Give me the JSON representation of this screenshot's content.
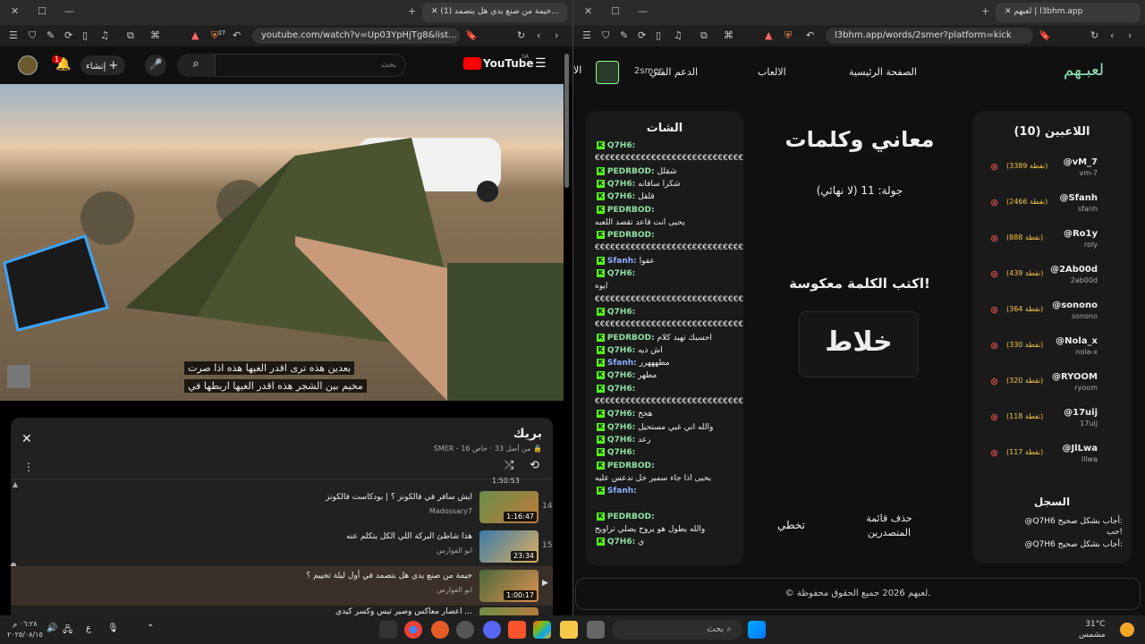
{
  "left_window": {
    "tab_title": "(1) خيمة من صنع يدي هل بتصمد...",
    "url": "youtube.com/watch?v=Up03YpHjTg8&list...",
    "brave_badge": "27"
  },
  "youtube": {
    "logo_text": "YouTube",
    "country": "SA",
    "search_placeholder": "بحث",
    "create_label": "إنشاء",
    "notif_count": "1",
    "subtitle_line1": "بعدين هذه ترى اقدر الغيها هذه اذا صرت",
    "subtitle_line2": "مخيم بين الشجر  هذه اقدر الغيها اربطها في",
    "playlist_title": "بريك",
    "playlist_meta": "SMER - 16 من أصل 33",
    "playlist_owner_prefix": "خاص",
    "items": [
      {
        "index": "14",
        "title": "ايش سافر في فالكونز ؟ | بودكاست فالكونز",
        "channel": "Madossary7",
        "duration": "1:16:47"
      },
      {
        "index": "15",
        "title": "هذا شاطئ البركة اللي الكل يتكلم عنه",
        "channel": "ابو الفوارس",
        "duration": "23:34"
      },
      {
        "index": "",
        "title": "خيمة من صنع يدي هل بتصمد في أول ليلة تخييم ؟",
        "channel": "ابو الفوارس",
        "duration": "1:00:17"
      },
      {
        "index": "",
        "title": "اعصار معاكس وصير تيس وكسر كيدي ...",
        "channel": "",
        "duration": ""
      }
    ],
    "prev_duration": "1:50:53"
  },
  "right_window": {
    "tab_title": "لعبهم | l3bhm.app",
    "url": "l3bhm.app/words/2smer?platform=kick"
  },
  "l3bhm": {
    "logo": "لعبـهم",
    "nav": [
      "الصفحة الرئيسية",
      "الالعاب",
      "الدعم الفني",
      "الا"
    ],
    "username": "2smer",
    "players_title": "اللاعبين (10)",
    "players": [
      {
        "name": "@vM_7",
        "handle": "vm-7",
        "points": "(3389 نقطة)"
      },
      {
        "name": "@Sfanh",
        "handle": "sfanh",
        "points": "(2466 نقطة)"
      },
      {
        "name": "@Ro1y",
        "handle": "roly",
        "points": "(888 نقطة)"
      },
      {
        "name": "@2Ab00d",
        "handle": "2ab00d",
        "points": "(439 نقطة)"
      },
      {
        "name": "@sonono",
        "handle": "sonono",
        "points": "(364 نقطة)"
      },
      {
        "name": "@Nola_x",
        "handle": "nola-x",
        "points": "(330 نقطة)"
      },
      {
        "name": "@RYOOM",
        "handle": "ryoom",
        "points": "(320 نقطة)"
      },
      {
        "name": "@17uij",
        "handle": "17uij",
        "points": "(118 نقطة)"
      },
      {
        "name": "@JlLwa",
        "handle": "illwa",
        "points": "(117 نقطة)"
      }
    ],
    "game_title": "معاني وكلمات",
    "round": "جولة: 11 (لا نهائي)",
    "prompt": "اكتب الكلمة معكوسة!",
    "word": "خلاط",
    "skip_label": "تخطي",
    "clear_label_1": "حذف قائمة",
    "clear_label_2": "المتصدرين",
    "chat_title": "الشات",
    "chat": [
      {
        "user": "Q7H6:",
        "text": "",
        "style": "g"
      },
      {
        "user": "",
        "text": "€€€€€€€€€€€€€€€€€€€€€€€€€€€€€€€€",
        "style": ""
      },
      {
        "user": "PEDRBOD:",
        "text": "شقلل",
        "style": "g"
      },
      {
        "user": "Q7H6:",
        "text": "شكرا سافانه",
        "style": "g"
      },
      {
        "user": "Q7H6:",
        "text": "قلقل",
        "style": "g"
      },
      {
        "user": "PEDRBOD:",
        "text": "",
        "style": "g"
      },
      {
        "user": "",
        "text": "يحيى انت قاعد تقصد اللعبه",
        "style": ""
      },
      {
        "user": "PEDRBOD:",
        "text": "",
        "style": "g"
      },
      {
        "user": "",
        "text": "€€€€€€€€€€€€€€€€€€€€€€€€€€€€€€€€",
        "style": ""
      },
      {
        "user": "Sfanh:",
        "text": "عفوا",
        "style": "b"
      },
      {
        "user": "Q7H6:",
        "text": "",
        "style": "g"
      },
      {
        "user": "",
        "text": "ايوه",
        "style": ""
      },
      {
        "user": "",
        "text": "€€€€€€€€€€€€€€€€€€€€€€€€€€€€€€€€",
        "style": ""
      },
      {
        "user": "Q7H6:",
        "text": "",
        "style": "g"
      },
      {
        "user": "",
        "text": "€€€€€€€€€€€€€€€€€€€€€€€€€€€€€€€€",
        "style": ""
      },
      {
        "user": "PEDRBOD:",
        "text": "احسبك تهبد كلام",
        "style": "g"
      },
      {
        "user": "Q7H6:",
        "text": "اش ذيه",
        "style": "g"
      },
      {
        "user": "Sfanh:",
        "text": "مطهههرر",
        "style": "b"
      },
      {
        "user": "Q7H6:",
        "text": "مطهر",
        "style": "g"
      },
      {
        "user": "Q7H6:",
        "text": "",
        "style": "g"
      },
      {
        "user": "",
        "text": "€€€€€€€€€€€€€€€€€€€€€€€€€€€€€€€€",
        "style": ""
      },
      {
        "user": "Q7H6:",
        "text": "هخخ",
        "style": "g"
      },
      {
        "user": "Q7H6:",
        "text": "والله اني غبي مستحيل",
        "style": "g"
      },
      {
        "user": "Q7H6:",
        "text": "رعد",
        "style": "g"
      },
      {
        "user": "Q7H6:",
        "text": "",
        "style": "g"
      },
      {
        "user": "PEDRBOD:",
        "text": "",
        "style": "g"
      },
      {
        "user": "",
        "text": "يحيى اذا جاء سمير خل ندعس عليه",
        "style": ""
      },
      {
        "user": "Sfanh:",
        "text": "",
        "style": "b"
      },
      {
        "user": "",
        "text": "",
        "style": ""
      },
      {
        "user": "PEDRBOD:",
        "text": "",
        "style": "g"
      },
      {
        "user": "",
        "text": "والله يطول هو يروح يصلي تراويح",
        "style": ""
      },
      {
        "user": "Q7H6:",
        "text": "ي",
        "style": "g"
      }
    ],
    "log_title": "السجل",
    "log": [
      "@Q7H6 أجاب بشكل صحيح:",
      "حب!",
      "@Q7H6 أجاب بشكل صحيح:"
    ],
    "footer": "© لعبهم 2026 جميع الحقوق محفوظة."
  },
  "taskbar": {
    "search_placeholder": "بحث",
    "time": "٠٦:٢٨ م",
    "date": "٢٠٢٥/٠٨/١٥",
    "weather_temp": "31°C",
    "weather_desc": "مشمس",
    "lang": "ع"
  }
}
